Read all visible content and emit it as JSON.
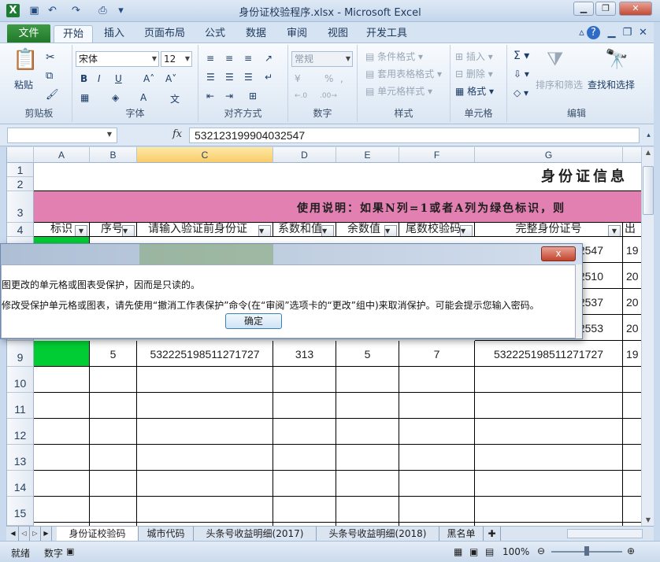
{
  "window": {
    "title": "身份证校验程序.xlsx - Microsoft Excel"
  },
  "ribbon_tabs": [
    "文件",
    "开始",
    "插入",
    "页面布局",
    "公式",
    "数据",
    "审阅",
    "视图",
    "开发工具"
  ],
  "ribbon": {
    "paste": "粘贴",
    "font_name": "宋体",
    "font_size": "12",
    "number_format": "常规",
    "conditional_format": "条件格式",
    "table_format": "套用表格格式",
    "cell_styles": "单元格样式",
    "insert": "插入",
    "delete": "删除",
    "format": "格式",
    "sort_filter": "排序和筛选",
    "find_select": "查找和选择",
    "groups": [
      "剪贴板",
      "字体",
      "对齐方式",
      "数字",
      "样式",
      "单元格",
      "编辑"
    ]
  },
  "formula_bar": {
    "fx": "fx",
    "value": "532123199904032547"
  },
  "columns": [
    "A",
    "B",
    "C",
    "D",
    "E",
    "F",
    "G"
  ],
  "rows": [
    "1",
    "2",
    "3",
    "4",
    "9",
    "10",
    "11",
    "12",
    "13",
    "14",
    "15"
  ],
  "sheet": {
    "title": "身份证信息",
    "instruction": "使用说明：如果N列=1或者A列为绿色标识，则",
    "headers": [
      "标识",
      "序号",
      "请输入验证前身份证",
      "系数和值",
      "余数值",
      "尾数校验码",
      "完整身份证号",
      "出"
    ],
    "partial_g": [
      "2547",
      "2510",
      "2537",
      "2553"
    ],
    "partial_h": [
      "19",
      "20",
      "20",
      "20"
    ],
    "row9": [
      "",
      "5",
      "532225198511271727",
      "313",
      "5",
      "7",
      "532225198511271727",
      "19"
    ]
  },
  "dialog": {
    "close": "x",
    "line1": "图更改的单元格或图表受保护，因而是只读的。",
    "line2": "修改受保护单元格或图表，请先使用“撤消工作表保护”命令(在“审阅”选项卡的“更改”组中)来取消保护。可能会提示您输入密码。",
    "ok": "确定"
  },
  "sheet_tabs": [
    "身份证校验码",
    "城市代码",
    "头条号收益明细(2017)",
    "头条号收益明细(2018)",
    "黑名单"
  ],
  "status": {
    "ready": "就绪",
    "numlock": "数字",
    "zoom": "100%"
  },
  "colors": {
    "pink_band": "#e280b2",
    "green": "#00cc33",
    "excel_green": "#217346"
  }
}
